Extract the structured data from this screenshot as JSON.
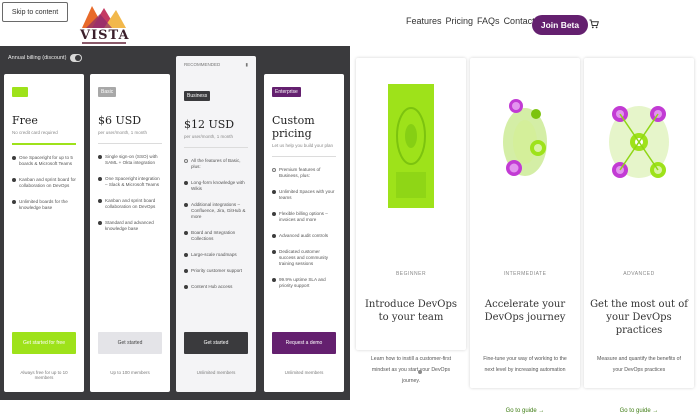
{
  "header": {
    "skip_link": "Skip to content",
    "logo_text": "VISTA",
    "nav": [
      {
        "label": "Features"
      },
      {
        "label": "Pricing"
      },
      {
        "label": "FAQs"
      },
      {
        "label": "Contact"
      }
    ],
    "join_label": "Join Beta",
    "cart_icon": "cart-icon"
  },
  "pricing": {
    "billing_label": "Annual billing (discount)",
    "plans": [
      {
        "badge": "Free",
        "badge_color": "#9ee21a",
        "name": "Free",
        "subtitle": "No credit card required",
        "features": [
          "One Spaceright for up to 5 boards & Microsoft Teams",
          "Kanban and sprint board for collaboration on DevOps",
          "Unlimited boards for the knowledge base"
        ],
        "cta": "Get started for free",
        "cta_bg": "#9ee21a",
        "cta_color": "#ffffff",
        "note": "Always free for up to 10 members"
      },
      {
        "badge": "Basic",
        "badge_color": "#a8a8a8",
        "name": "$6 USD",
        "subtitle": "per user/month, 1 month",
        "features": [
          "Single sign-on (SSO) with SAML + Okta integration",
          "One Spaceright integration – Slack & Microsoft Teams",
          "Kanban and sprint board collaboration on DevOps",
          "Standard and advanced knowledge base"
        ],
        "cta": "Get started",
        "cta_bg": "#e4e4e8",
        "cta_color": "#444444",
        "note": "Up to 100 members"
      },
      {
        "top_label": "RECOMMENDED",
        "badge": "Business",
        "badge_color": "#3a3a3d",
        "name": "$12 USD",
        "subtitle": "per user/month, 1 month",
        "features": [
          "All the features of Basic, plus:",
          "Long-form knowledge with Wikis",
          "Additional integrations – Confluence, Jira, GitHub & more",
          "Board and Integration Collections",
          "Large-scale roadmaps",
          "Priority customer support",
          "Content Hub access"
        ],
        "cta": "Get started",
        "cta_bg": "#3a3a3d",
        "cta_color": "#ffffff",
        "note": "Unlimited members"
      },
      {
        "badge": "Enterprise",
        "badge_color": "#64206f",
        "name": "Custom pricing",
        "subtitle": "Let us help you build your plan",
        "features": [
          "Premium features of Business, plus:",
          "Unlimited Spaces with your teams",
          "Flexible billing options – invoices and more",
          "Advanced audit controls",
          "Dedicated customer success and community training sessions",
          "99.9% uptime SLA and priority support"
        ],
        "cta": "Request a demo",
        "cta_bg": "#64206f",
        "cta_color": "#ffffff",
        "note": "Unlimited members"
      }
    ]
  },
  "cards": [
    {
      "level": "BEGINNER",
      "title": "Introduce DevOps to your team",
      "description": "Learn how to instill a customer-first mindset as you start your DevOps journey.",
      "link": ""
    },
    {
      "level": "INTERMEDIATE",
      "title": "Accelerate your DevOps journey",
      "description": "Fine-tune your way of working to the next level by increasing automation",
      "link": "Go to guide →"
    },
    {
      "level": "ADVANCED",
      "title": "Get the most out of your DevOps practices",
      "description": "Measure and quantify the benefits of your DevOps practices",
      "link": "Go to guide →"
    }
  ],
  "colors": {
    "accent_green": "#9ee21a",
    "brand_purple": "#64206f",
    "dark_panel": "#3a3a3d"
  }
}
